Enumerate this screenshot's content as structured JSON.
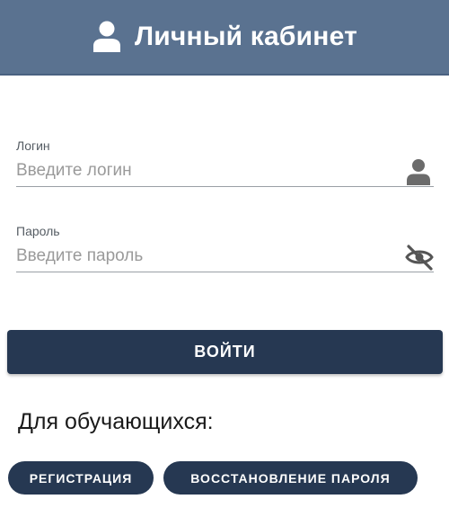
{
  "header": {
    "icon": "user-icon",
    "title": "Личный кабинет",
    "background_color": "#5a7290"
  },
  "login_field": {
    "label": "Логин",
    "placeholder": "Введите логин",
    "value": "",
    "icon": "user-icon"
  },
  "password_field": {
    "label": "Пароль",
    "placeholder": "Введите пароль",
    "value": "",
    "icon": "eye-off-icon"
  },
  "login_button": {
    "label": "ВОЙТИ"
  },
  "students_section": {
    "title": "Для обучающихся:",
    "register_label": "РЕГИСТРАЦИЯ",
    "restore_label": "ВОССТАНОВЛЕНИЕ ПАРОЛЯ"
  },
  "colors": {
    "accent": "#263852",
    "header": "#5a7290"
  }
}
